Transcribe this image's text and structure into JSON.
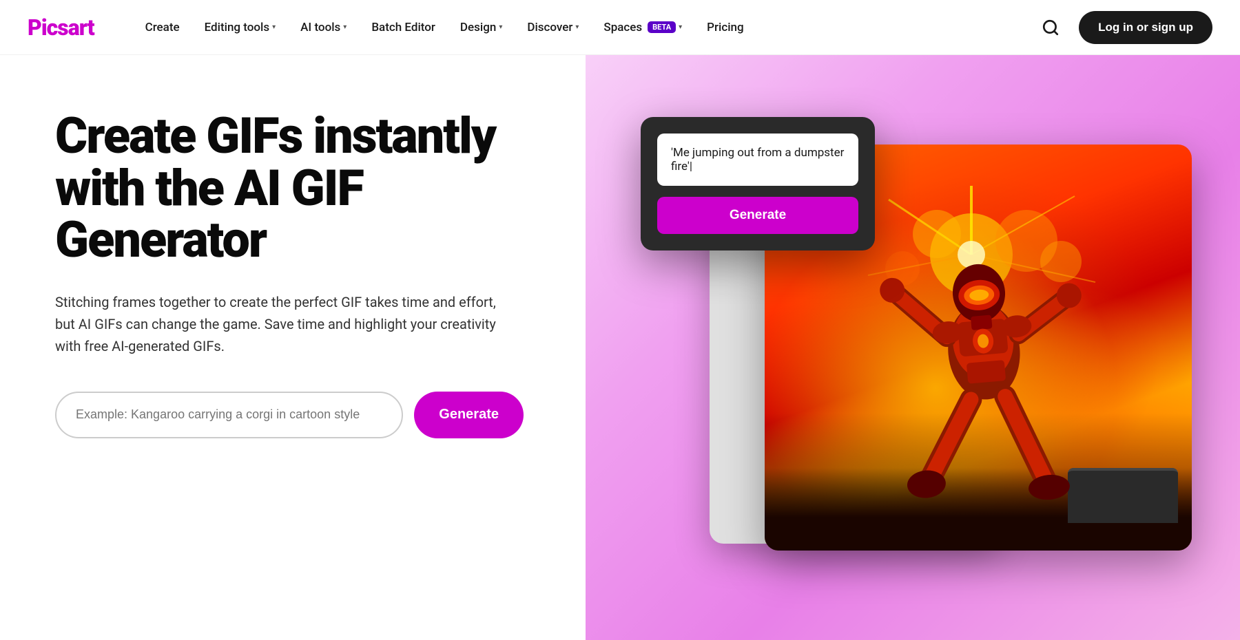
{
  "navbar": {
    "logo": "Picsart",
    "links": [
      {
        "label": "Create",
        "has_dropdown": false,
        "id": "create"
      },
      {
        "label": "Editing tools",
        "has_dropdown": true,
        "id": "editing-tools"
      },
      {
        "label": "AI tools",
        "has_dropdown": true,
        "id": "ai-tools"
      },
      {
        "label": "Batch Editor",
        "has_dropdown": false,
        "id": "batch-editor"
      },
      {
        "label": "Design",
        "has_dropdown": true,
        "id": "design"
      },
      {
        "label": "Discover",
        "has_dropdown": true,
        "id": "discover"
      },
      {
        "label": "Spaces",
        "has_dropdown": true,
        "has_beta": true,
        "id": "spaces"
      },
      {
        "label": "Pricing",
        "has_dropdown": false,
        "id": "pricing"
      }
    ],
    "login_label": "Log in or sign up"
  },
  "hero": {
    "title": "Create GIFs instantly with the AI GIF Generator",
    "subtitle": "Stitching frames together to create the perfect GIF takes time and effort, but AI GIFs can change the game. Save time and highlight your creativity with free AI-generated GIFs.",
    "input_placeholder": "Example: Kangaroo carrying a corgi in cartoon style",
    "generate_button": "Generate"
  },
  "ai_card": {
    "prompt_text": "'Me jumping out from a dumpster fire'|",
    "generate_button": "Generate"
  },
  "colors": {
    "brand_purple": "#cc00cc",
    "dark_bg": "#1a1a1a",
    "beta_badge": "#5b00c8"
  }
}
